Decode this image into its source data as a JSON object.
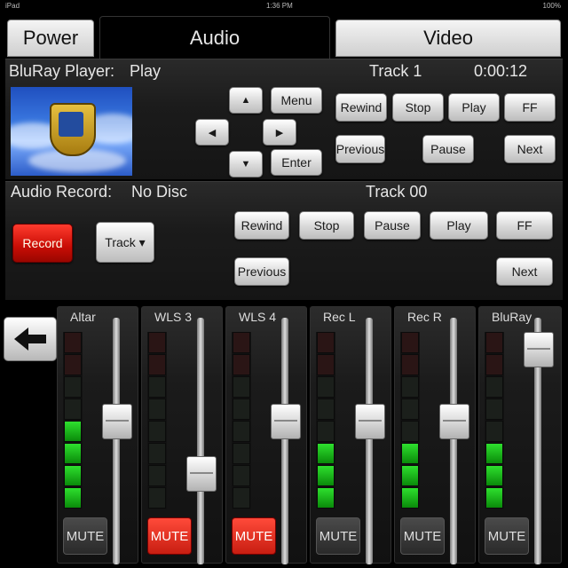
{
  "status_bar": {
    "left": "iPad",
    "time": "1:36 PM",
    "right": "100%"
  },
  "tabs": [
    {
      "label": "Power",
      "active": false
    },
    {
      "label": "Audio",
      "active": true
    },
    {
      "label": "Video",
      "active": false
    }
  ],
  "bluray": {
    "title": "BluRay Player:",
    "state": "Play",
    "track": "Track 1",
    "time": "0:00:12",
    "nav": {
      "up": "▲",
      "down": "▼",
      "left": "◀",
      "right": "▶",
      "menu": "Menu",
      "enter": "Enter"
    },
    "transport": {
      "rewind": "Rewind",
      "stop": "Stop",
      "play": "Play",
      "ff": "FF",
      "previous": "Previous",
      "pause": "Pause",
      "next": "Next"
    }
  },
  "audio_record": {
    "title": "Audio Record:",
    "disc": "No Disc",
    "track": "Track 00",
    "record": "Record",
    "track_select": "Track ▾",
    "transport": {
      "rewind": "Rewind",
      "stop": "Stop",
      "pause": "Pause",
      "play": "Play",
      "ff": "FF",
      "previous": "Previous",
      "next": "Next"
    }
  },
  "mixer": {
    "back_icon": "back-arrow-icon",
    "channels": [
      {
        "name": "Altar",
        "mute": "MUTE",
        "muted": false,
        "level": 0.58,
        "meter_on": 4
      },
      {
        "name": "WLS 3",
        "mute": "MUTE",
        "muted": true,
        "level": 0.3,
        "meter_on": 0
      },
      {
        "name": "WLS 4",
        "mute": "MUTE",
        "muted": true,
        "level": 0.58,
        "meter_on": 0
      },
      {
        "name": "Rec L",
        "mute": "MUTE",
        "muted": false,
        "level": 0.58,
        "meter_on": 3
      },
      {
        "name": "Rec R",
        "mute": "MUTE",
        "muted": false,
        "level": 0.58,
        "meter_on": 3
      },
      {
        "name": "BluRay",
        "mute": "MUTE",
        "muted": false,
        "level": 0.97,
        "meter_on": 3
      }
    ]
  }
}
